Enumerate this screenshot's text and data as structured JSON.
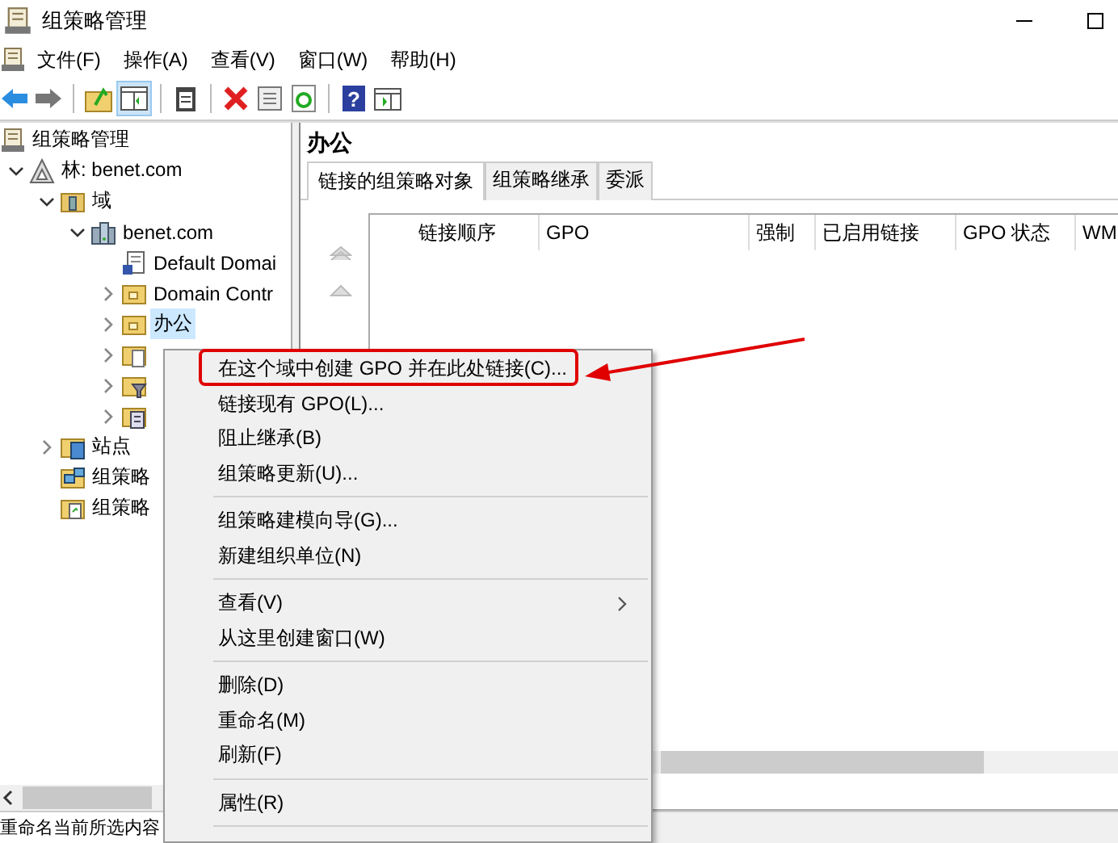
{
  "window": {
    "title": "组策略管理"
  },
  "help_button": "?",
  "menu_bar": [
    "文件(F)",
    "操作(A)",
    "查看(V)",
    "窗口(W)",
    "帮助(H)"
  ],
  "tree": [
    {
      "label": "组策略管理",
      "kind": "console",
      "selected": false,
      "children": [
        {
          "label": "林: benet.com",
          "kind": "forest",
          "expanded": true,
          "selected": false,
          "children": [
            {
              "label": "域",
              "kind": "domains",
              "expanded": true,
              "selected": false,
              "children": [
                {
                  "label": "benet.com",
                  "kind": "domain",
                  "expanded": true,
                  "selected": false,
                  "children": [
                    {
                      "label": "Default Domai",
                      "kind": "gpo",
                      "selected": false
                    },
                    {
                      "label": "Domain Contr",
                      "kind": "ou",
                      "expanded": false,
                      "selected": false
                    },
                    {
                      "label": "办公",
                      "kind": "ou",
                      "expanded": false,
                      "selected": true
                    },
                    {
                      "kind": "ou-doc",
                      "expanded": false,
                      "selected": false
                    },
                    {
                      "kind": "ou-filter",
                      "expanded": false,
                      "selected": false
                    },
                    {
                      "kind": "ou-list",
                      "expanded": false,
                      "selected": false
                    }
                  ]
                }
              ]
            },
            {
              "label": "站点",
              "kind": "sites",
              "expanded": false,
              "selected": false
            },
            {
              "label": "组策略",
              "kind": "modeling",
              "selected": false
            },
            {
              "label": "组策略",
              "kind": "results",
              "selected": false
            }
          ]
        }
      ]
    }
  ],
  "details": {
    "title": "办公",
    "tabs": [
      {
        "label": "链接的组策略对象",
        "selected": true
      },
      {
        "label": "组策略继承",
        "selected": false
      },
      {
        "label": "委派",
        "selected": false
      }
    ],
    "columns": [
      "链接顺序",
      "GPO",
      "强制",
      "已启用链接",
      "GPO 状态",
      "WM"
    ]
  },
  "context_menu": [
    [
      {
        "label": "在这个域中创建 GPO 并在此处链接(C)...",
        "submenu": false
      },
      {
        "label": "链接现有 GPO(L)...",
        "submenu": false
      },
      {
        "label": "阻止继承(B)",
        "submenu": false
      },
      {
        "label": "组策略更新(U)...",
        "submenu": false
      }
    ],
    [
      {
        "label": "组策略建模向导(G)...",
        "submenu": false
      },
      {
        "label": "新建组织单位(N)",
        "submenu": false
      }
    ],
    [
      {
        "label": "查看(V)",
        "submenu": true
      },
      {
        "label": "从这里创建窗口(W)",
        "submenu": false
      }
    ],
    [
      {
        "label": "删除(D)",
        "submenu": false
      },
      {
        "label": "重命名(M)",
        "submenu": false
      },
      {
        "label": "刷新(F)",
        "submenu": false
      }
    ],
    [
      {
        "label": "属性(R)",
        "submenu": false
      }
    ]
  ],
  "status_bar": "重命名当前所选内容"
}
